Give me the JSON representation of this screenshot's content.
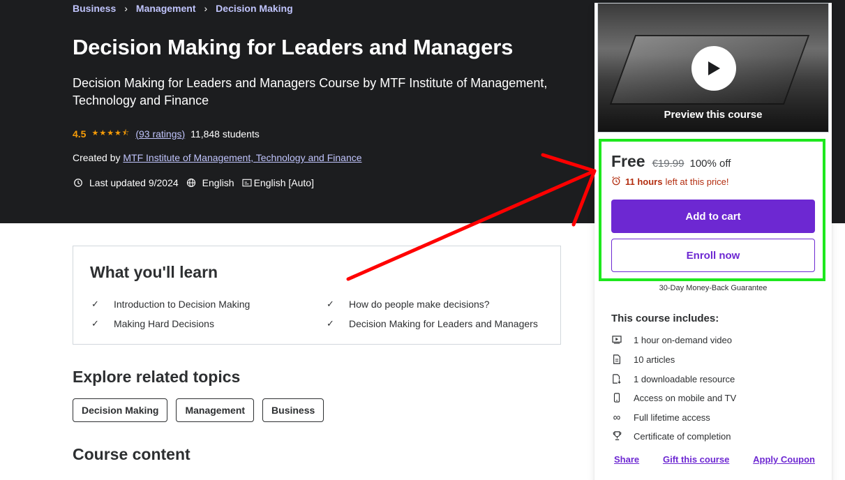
{
  "breadcrumb": [
    "Business",
    "Management",
    "Decision Making"
  ],
  "course": {
    "title": "Decision Making for Leaders and Managers",
    "subtitle": "Decision Making for Leaders and Managers Course by MTF Institute of Management, Technology and Finance",
    "rating": "4.5",
    "ratings_count": "(93 ratings)",
    "students": "11,848 students",
    "created_by_label": "Created by",
    "author": "MTF Institute of Management, Technology and Finance",
    "last_updated": "Last updated 9/2024",
    "language": "English",
    "captions": "English [Auto]"
  },
  "learn": {
    "title": "What you'll learn",
    "items": [
      "Introduction to Decision Making",
      "How do people make decisions?",
      "Making Hard Decisions",
      "Decision Making for Leaders and Managers"
    ]
  },
  "related": {
    "title": "Explore related topics",
    "topics": [
      "Decision Making",
      "Management",
      "Business"
    ]
  },
  "course_content": {
    "title": "Course content"
  },
  "sidebar": {
    "preview_label": "Preview this course",
    "price": "Free",
    "original_price": "€19.99",
    "discount": "100% off",
    "timer_bold": "11 hours",
    "timer_rest": "left at this price!",
    "add_to_cart": "Add to cart",
    "enroll_now": "Enroll now",
    "guarantee": "30-Day Money-Back Guarantee",
    "includes_title": "This course includes:",
    "includes": [
      {
        "icon": "video-icon",
        "label": "1 hour on-demand video"
      },
      {
        "icon": "article-icon",
        "label": "10 articles"
      },
      {
        "icon": "download-file-icon",
        "label": "1 downloadable resource"
      },
      {
        "icon": "mobile-icon",
        "label": "Access on mobile and TV"
      },
      {
        "icon": "infinity-icon",
        "label": "Full lifetime access"
      },
      {
        "icon": "trophy-icon",
        "label": "Certificate of completion"
      }
    ],
    "links": [
      "Share",
      "Gift this course",
      "Apply Coupon"
    ]
  },
  "colors": {
    "hero_bg": "#1c1d1f",
    "accent_purple": "#6d28d2",
    "link_lavender": "#c0c4fc",
    "star_orange": "#f69c08",
    "timer_red": "#b32d0f",
    "annotation_red": "#ff0000",
    "annotation_green": "#1ee81e"
  }
}
